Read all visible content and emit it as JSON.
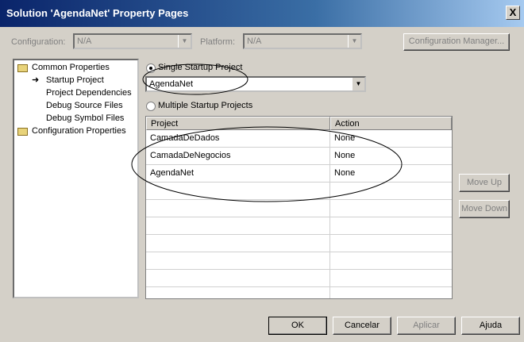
{
  "window": {
    "title": "Solution 'AgendaNet' Property Pages",
    "close_glyph": "X"
  },
  "config_row": {
    "configuration_label": "Configuration:",
    "configuration_value": "N/A",
    "platform_label": "Platform:",
    "platform_value": "N/A",
    "config_manager_label": "Configuration Manager..."
  },
  "tree": {
    "items": [
      {
        "label": "Common Properties"
      },
      {
        "label": "Startup Project"
      },
      {
        "label": "Project Dependencies"
      },
      {
        "label": "Debug Source Files"
      },
      {
        "label": "Debug Symbol Files"
      },
      {
        "label": "Configuration Properties"
      }
    ]
  },
  "startup": {
    "single_label": "Single Startup Project",
    "single_selected": true,
    "single_value": "AgendaNet",
    "multiple_label": "Multiple Startup Projects"
  },
  "grid": {
    "columns": [
      "Project",
      "Action"
    ],
    "rows": [
      {
        "project": "CamadaDeDados",
        "action": "None"
      },
      {
        "project": "CamadaDeNegocios",
        "action": "None"
      },
      {
        "project": "AgendaNet",
        "action": "None"
      }
    ]
  },
  "side_buttons": {
    "move_up": "Move Up",
    "move_down": "Move Down"
  },
  "footer": {
    "ok": "OK",
    "cancel": "Cancelar",
    "apply": "Aplicar",
    "help": "Ajuda"
  }
}
